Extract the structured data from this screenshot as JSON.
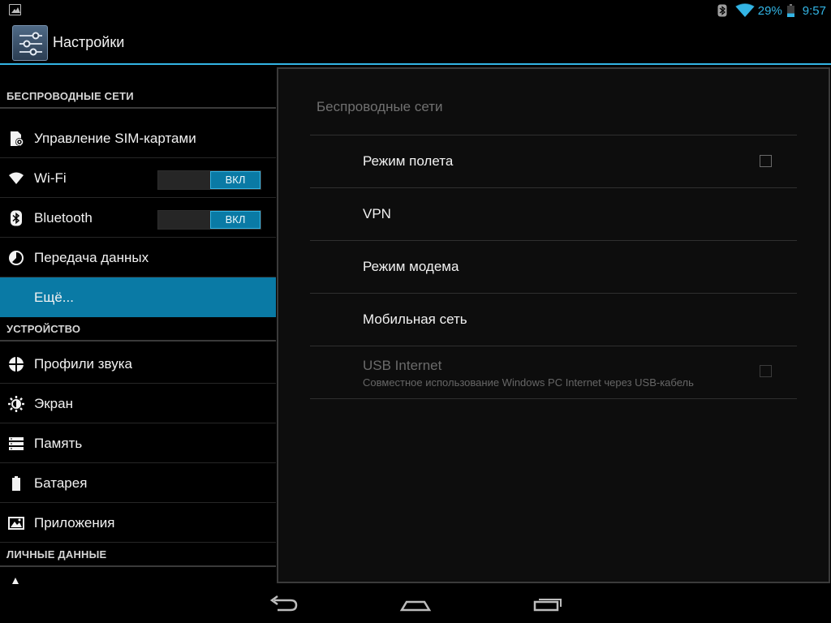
{
  "status_bar": {
    "battery_percent": "29%",
    "time": "9:57",
    "icons": [
      "gallery-icon",
      "bluetooth-icon",
      "wifi-icon",
      "battery-icon"
    ],
    "accent": "#33b5e5"
  },
  "action_bar": {
    "title": "Настройки",
    "icon": "settings-sliders-icon"
  },
  "left_pane": {
    "sections": {
      "wireless": "БЕСПРОВОДНЫЕ СЕТИ",
      "device": "УСТРОЙСТВО",
      "personal": "ЛИЧНЫЕ ДАННЫЕ"
    },
    "items": [
      {
        "label": "Управление SIM-картами",
        "icon": "sim-settings-icon"
      },
      {
        "label": "Wi-Fi",
        "icon": "wifi-icon",
        "toggle": "ВКЛ"
      },
      {
        "label": "Bluetooth",
        "icon": "bluetooth-icon",
        "toggle": "ВКЛ"
      },
      {
        "label": "Передача данных",
        "icon": "data-usage-icon"
      },
      {
        "label": "Ещё...",
        "selected": true
      },
      {
        "label": "Профили звука",
        "icon": "sound-profiles-icon"
      },
      {
        "label": "Экран",
        "icon": "display-icon"
      },
      {
        "label": "Память",
        "icon": "storage-icon"
      },
      {
        "label": "Батарея",
        "icon": "battery-icon"
      },
      {
        "label": "Приложения",
        "icon": "apps-icon"
      }
    ],
    "selected_color": "#0a7aa5"
  },
  "right_pane": {
    "title": "Беспроводные сети",
    "items": [
      {
        "label": "Режим полета",
        "checkbox": true,
        "checked": false
      },
      {
        "label": "VPN"
      },
      {
        "label": "Режим модема"
      },
      {
        "label": "Мобильная сеть"
      },
      {
        "label": "USB Internet",
        "summary": "Совместное использование Windows PC Internet через USB-кабель",
        "checkbox": true,
        "checked": false,
        "disabled": true
      }
    ]
  },
  "nav_bar": {
    "buttons": [
      "back-icon",
      "home-icon",
      "recent-apps-icon"
    ]
  }
}
